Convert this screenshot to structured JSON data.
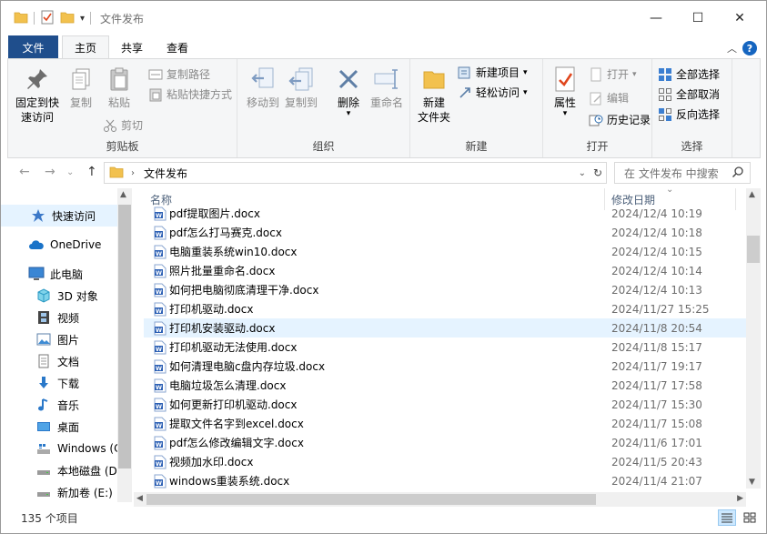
{
  "window": {
    "title": "文件发布",
    "minimize_glyph": "—",
    "maximize_glyph": "☐",
    "close_glyph": "✕"
  },
  "tabs": [
    {
      "label": "文件"
    },
    {
      "label": "主页"
    },
    {
      "label": "共享"
    },
    {
      "label": "查看"
    }
  ],
  "ribbon": {
    "clipboard": {
      "label": "剪贴板",
      "pin": "固定到快\n速访问",
      "pin_line1": "固定到快",
      "pin_line2": "速访问",
      "copy": "复制",
      "paste": "粘贴",
      "cut": "剪切",
      "copy_path": "复制路径",
      "paste_shortcut": "粘贴快捷方式"
    },
    "organize": {
      "label": "组织",
      "move_to": "移动到",
      "copy_to": "复制到",
      "delete": "删除",
      "rename": "重命名"
    },
    "new": {
      "label": "新建",
      "new_folder_line1": "新建",
      "new_folder_line2": "文件夹",
      "new_item": "新建项目",
      "easy_access": "轻松访问"
    },
    "open": {
      "label": "打开",
      "properties": "属性",
      "open": "打开",
      "edit": "编辑",
      "history": "历史记录"
    },
    "select": {
      "label": "选择",
      "select_all": "全部选择",
      "select_none": "全部取消",
      "invert": "反向选择"
    }
  },
  "address": {
    "path": "文件发布",
    "search_placeholder": "在 文件发布 中搜索"
  },
  "nav_pane": [
    {
      "label": "快速访问",
      "icon": "star-icon",
      "selected": true
    },
    {
      "label": "OneDrive",
      "icon": "cloud-icon",
      "selected": false
    },
    {
      "label": "此电脑",
      "icon": "pc-icon",
      "selected": false
    },
    {
      "label": "3D 对象",
      "icon": "cube-icon",
      "selected": false
    },
    {
      "label": "视频",
      "icon": "film-icon",
      "selected": false
    },
    {
      "label": "图片",
      "icon": "picture-icon",
      "selected": false
    },
    {
      "label": "文档",
      "icon": "document-icon",
      "selected": false
    },
    {
      "label": "下载",
      "icon": "download-icon",
      "selected": false
    },
    {
      "label": "音乐",
      "icon": "music-icon",
      "selected": false
    },
    {
      "label": "桌面",
      "icon": "desktop-icon",
      "selected": false
    },
    {
      "label": "Windows (C",
      "icon": "windows-drive-icon",
      "selected": false
    },
    {
      "label": "本地磁盘 (D",
      "icon": "drive-icon",
      "selected": false
    },
    {
      "label": "新加卷 (E:)",
      "icon": "drive-icon",
      "selected": false
    }
  ],
  "columns": {
    "name": "名称",
    "modified": "修改日期"
  },
  "files": [
    {
      "name": "pdf提取图片.docx",
      "date": "2024/12/4 10:19"
    },
    {
      "name": "pdf怎么打马赛克.docx",
      "date": "2024/12/4 10:18"
    },
    {
      "name": "电脑重装系统win10.docx",
      "date": "2024/12/4 10:15"
    },
    {
      "name": "照片批量重命名.docx",
      "date": "2024/12/4 10:14"
    },
    {
      "name": "如何把电脑彻底清理干净.docx",
      "date": "2024/12/4 10:13"
    },
    {
      "name": "打印机驱动.docx",
      "date": "2024/11/27 15:25"
    },
    {
      "name": "打印机安装驱动.docx",
      "date": "2024/11/8 20:54",
      "highlight": true
    },
    {
      "name": "打印机驱动无法使用.docx",
      "date": "2024/11/8 15:17"
    },
    {
      "name": "如何清理电脑c盘内存垃圾.docx",
      "date": "2024/11/7 19:17"
    },
    {
      "name": "电脑垃圾怎么清理.docx",
      "date": "2024/11/7 17:58"
    },
    {
      "name": "如何更新打印机驱动.docx",
      "date": "2024/11/7 15:30"
    },
    {
      "name": "提取文件名字到excel.docx",
      "date": "2024/11/7 15:08"
    },
    {
      "name": "pdf怎么修改编辑文字.docx",
      "date": "2024/11/6 17:01"
    },
    {
      "name": "视频加水印.docx",
      "date": "2024/11/5 20:43"
    },
    {
      "name": "windows重装系统.docx",
      "date": "2024/11/4 21:07"
    }
  ],
  "status": {
    "count": "135 个项目"
  },
  "colors": {
    "file_tab": "#1f4e8c",
    "accent": "#1565c0",
    "selection": "#e5f3ff",
    "folder": "#f2c14e",
    "word": "#2b5fb4"
  }
}
